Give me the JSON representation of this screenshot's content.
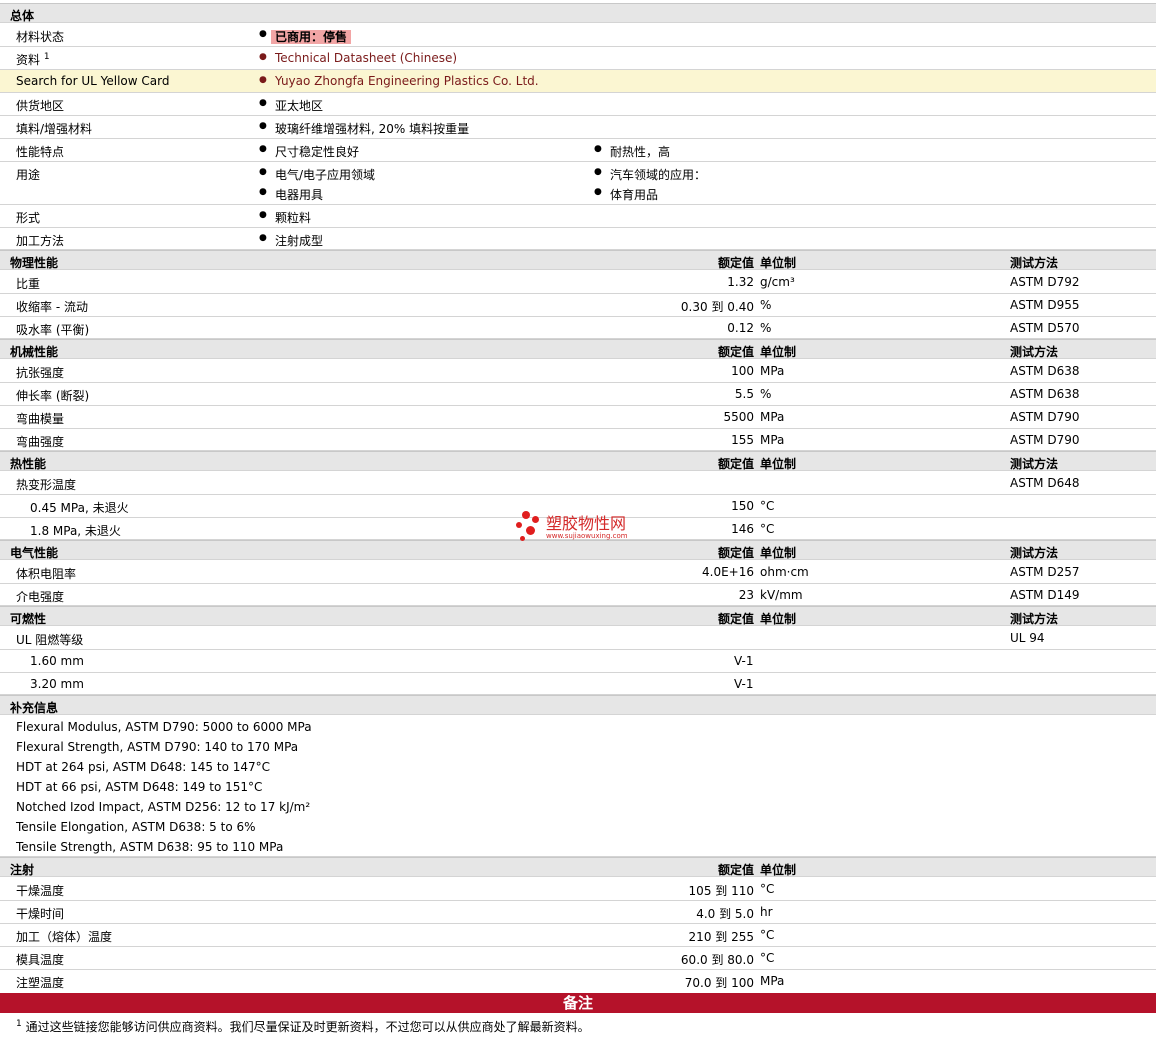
{
  "general": {
    "title": "总体",
    "material_status": {
      "label": "材料状态",
      "value": "已商用：停售"
    },
    "docs": {
      "label": "资料",
      "sup": "1",
      "value": "Technical Datasheet (Chinese)"
    },
    "ul": {
      "label": "Search for UL Yellow Card",
      "value": "Yuyao Zhongfa Engineering Plastics Co. Ltd."
    },
    "region": {
      "label": "供货地区",
      "value": "亚太地区"
    },
    "filler": {
      "label": "填料/增强材料",
      "value": "玻璃纤维增强材料, 20% 填料按重量"
    },
    "features": {
      "label": "性能特点",
      "values": [
        "尺寸稳定性良好",
        "耐热性，高"
      ]
    },
    "uses": {
      "label": "用途",
      "values": [
        "电气/电子应用领域",
        "汽车领域的应用：",
        "电器用具",
        "体育用品"
      ]
    },
    "form": {
      "label": "形式",
      "value": "颗粒料"
    },
    "processing": {
      "label": "加工方法",
      "value": "注射成型"
    }
  },
  "headers": {
    "nominal": "额定值",
    "unit": "单位制",
    "test": "测试方法"
  },
  "physical": {
    "title": "物理性能",
    "rows": [
      {
        "label": "比重",
        "value": "1.32",
        "unit": "g/cm³",
        "test": "ASTM D792"
      },
      {
        "label": "收缩率 - 流动",
        "value": "0.30 到  0.40",
        "unit": "%",
        "test": "ASTM D955"
      },
      {
        "label": "吸水率 (平衡)",
        "value": "0.12",
        "unit": "%",
        "test": "ASTM D570"
      }
    ]
  },
  "mechanical": {
    "title": "机械性能",
    "rows": [
      {
        "label": "抗张强度",
        "value": "100",
        "unit": "MPa",
        "test": "ASTM D638"
      },
      {
        "label": "伸长率 (断裂)",
        "value": "5.5",
        "unit": "%",
        "test": "ASTM D638"
      },
      {
        "label": "弯曲模量",
        "value": "5500",
        "unit": "MPa",
        "test": "ASTM D790"
      },
      {
        "label": "弯曲强度",
        "value": "155",
        "unit": "MPa",
        "test": "ASTM D790"
      }
    ]
  },
  "thermal": {
    "title": "热性能",
    "hdt": {
      "label": "热变形温度",
      "test": "ASTM D648"
    },
    "rows": [
      {
        "label": "0.45 MPa, 未退火",
        "value": "150",
        "unit": "°C"
      },
      {
        "label": "1.8 MPa, 未退火",
        "value": "146",
        "unit": "°C"
      }
    ]
  },
  "electrical": {
    "title": "电气性能",
    "rows": [
      {
        "label": "体积电阻率",
        "value": "4.0E+16",
        "unit": "ohm·cm",
        "test": "ASTM D257"
      },
      {
        "label": "介电强度",
        "value": "23",
        "unit": "kV/mm",
        "test": "ASTM D149"
      }
    ]
  },
  "flammability": {
    "title": "可燃性",
    "ul": {
      "label": "UL 阻燃等级",
      "test": "UL 94"
    },
    "rows": [
      {
        "label": "1.60 mm",
        "value": "V-1"
      },
      {
        "label": "3.20 mm",
        "value": "V-1"
      }
    ]
  },
  "additional": {
    "title": "补充信息",
    "lines": [
      "Flexural Modulus, ASTM D790: 5000 to 6000 MPa",
      "Flexural Strength, ASTM D790: 140 to 170 MPa",
      "HDT at 264 psi, ASTM D648: 145 to 147°C",
      "HDT at 66 psi, ASTM D648: 149 to 151°C",
      "Notched Izod Impact, ASTM D256: 12 to 17 kJ/m²",
      "Tensile Elongation, ASTM D638: 5 to 6%",
      "Tensile Strength, ASTM D638: 95 to 110 MPa"
    ]
  },
  "injection": {
    "title": "注射",
    "rows": [
      {
        "label": "干燥温度",
        "value": "105 到  110",
        "unit": "°C"
      },
      {
        "label": "干燥时间",
        "value": "4.0 到  5.0",
        "unit": "hr"
      },
      {
        "label": "加工（熔体）温度",
        "value": "210 到  255",
        "unit": "°C"
      },
      {
        "label": "模具温度",
        "value": "60.0 到  80.0",
        "unit": "°C"
      },
      {
        "label": "注塑温度",
        "value": "70.0 到  100",
        "unit": "MPa"
      }
    ]
  },
  "notes": {
    "title": "备注",
    "footnote_num": "1",
    "footnote": "通过这些链接您能够访问供应商资料。我们尽量保证及时更新资料，不过您可以从供应商处了解最新资料。"
  },
  "watermark": {
    "name": "塑胶物性网",
    "url": "www.sujiaowuxing.com"
  },
  "colors": {
    "accent": "#b5122a",
    "badge": "#f2a5a5",
    "highlight": "#fbf6d2",
    "link": "#7a1a1a"
  }
}
